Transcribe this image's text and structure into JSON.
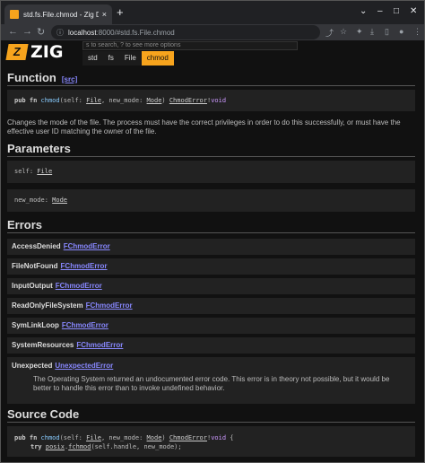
{
  "browser": {
    "tab_title": "std.fs.File.chmod - Zig Do",
    "tab_close": "×",
    "new_tab": "+",
    "url_host": "localhost",
    "url_path": ":8000/#std.fs.File.chmod",
    "window_controls": [
      "⌄",
      "–",
      "□",
      "✕"
    ]
  },
  "header": {
    "logo_text": "ZIG",
    "search_placeholder": "s to search, ? to see more options",
    "breadcrumbs": [
      "std",
      "fs",
      "File",
      "chmod"
    ]
  },
  "function": {
    "heading": "Function",
    "src_link": "[src]",
    "sig_pub_fn": "pub fn",
    "sig_name": "chmod",
    "sig_open": "(self: ",
    "sig_file": "File",
    "sig_mid": ", new_mode: ",
    "sig_mode": "Mode",
    "sig_close": ") ",
    "sig_err": "ChmodError",
    "sig_bang": "!",
    "sig_void": "void",
    "description": "Changes the mode of the file. The process must have the correct privileges in order to do this successfully, or must have the effective user ID matching the owner of the file."
  },
  "parameters": {
    "heading": "Parameters",
    "items": [
      {
        "prefix": "self: ",
        "type": "File"
      },
      {
        "prefix": "new_mode: ",
        "type": "Mode"
      }
    ]
  },
  "errors": {
    "heading": "Errors",
    "items": [
      {
        "name": "AccessDenied",
        "set": "FChmodError"
      },
      {
        "name": "FileNotFound",
        "set": "FChmodError"
      },
      {
        "name": "InputOutput",
        "set": "FChmodError"
      },
      {
        "name": "ReadOnlyFileSystem",
        "set": "FChmodError"
      },
      {
        "name": "SymLinkLoop",
        "set": "FChmodError"
      },
      {
        "name": "SystemResources",
        "set": "FChmodError"
      }
    ],
    "unexpected": {
      "name": "Unexpected",
      "set": "UnexpectedError",
      "doc": "The Operating System returned an undocumented error code. This error is in theory not possible, but it would be better to handle this error than to invoke undefined behavior."
    }
  },
  "source": {
    "heading": "Source Code",
    "line1_tail": " {",
    "line2_try": "try",
    "line2_posix": "posix",
    "line2_dot": ".",
    "line2_fchmod": "fchmod",
    "line2_args": "(self.handle, new_mode);"
  },
  "colors": {
    "accent": "#f7a41d",
    "link": "#8888ff",
    "bg": "#111111"
  }
}
